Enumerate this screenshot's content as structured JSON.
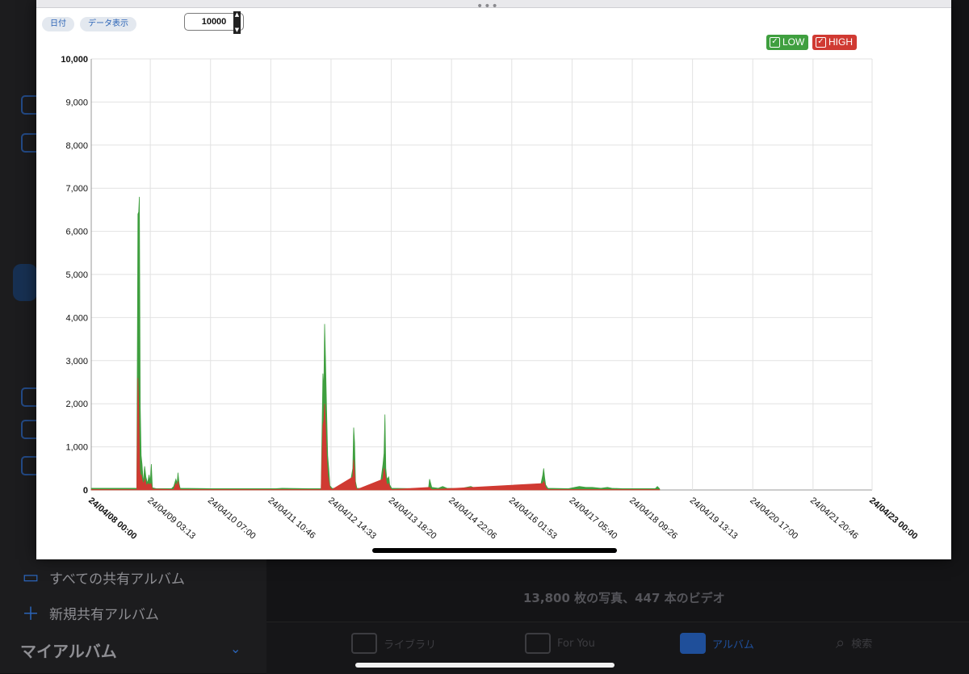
{
  "background": {
    "sidebar_items": [
      {
        "icon": "shared-album-icon",
        "label": "すべての共有アルバム"
      },
      {
        "icon": "plus-icon",
        "label": "新規共有アルバム"
      }
    ],
    "my_albums_heading": "マイアルバム",
    "counts_text": "13,800 枚の写真、447 本のビデオ",
    "tabs": [
      {
        "label": "ライブラリ",
        "icon": "library-icon"
      },
      {
        "label": "For You",
        "icon": "for-you-icon"
      },
      {
        "label": "アルバム",
        "icon": "album-icon"
      },
      {
        "label": "検索",
        "icon": "search-icon"
      }
    ],
    "accent": "#2b64b8"
  },
  "toolbar": {
    "date_button": "日付",
    "data_button": "データ表示",
    "max_value": "10000"
  },
  "legend": {
    "low_label": "LOW",
    "high_label": "HIGH",
    "low_color": "#3f9f3f",
    "high_color": "#d03a32"
  },
  "chart_data": {
    "type": "area",
    "ylim": [
      0,
      10000
    ],
    "yticks": [
      "0",
      "1,000",
      "2,000",
      "3,000",
      "4,000",
      "5,000",
      "6,000",
      "7,000",
      "8,000",
      "9,000",
      "10,000"
    ],
    "xlim": [
      "2024-04-08 00:00",
      "2024-04-23 00:00"
    ],
    "xticks": [
      {
        "label": "24/04/08 00:00",
        "t": 0,
        "bold": true
      },
      {
        "label": "24/04/09 03:13",
        "t": 27.22
      },
      {
        "label": "24/04/10 07:00",
        "t": 55.0
      },
      {
        "label": "24/04/11 10:46",
        "t": 82.77
      },
      {
        "label": "24/04/12 14:33",
        "t": 110.55
      },
      {
        "label": "24/04/13 18:20",
        "t": 138.33
      },
      {
        "label": "24/04/14 22:06",
        "t": 166.1
      },
      {
        "label": "24/04/16 01:53",
        "t": 193.88
      },
      {
        "label": "24/04/17 05:40",
        "t": 221.67
      },
      {
        "label": "24/04/18 09:26",
        "t": 249.43
      },
      {
        "label": "24/04/19 13:13",
        "t": 277.22
      },
      {
        "label": "24/04/20 17:00",
        "t": 305.0
      },
      {
        "label": "24/04/21 20:46",
        "t": 332.77
      },
      {
        "label": "24/04/23 00:00",
        "t": 360,
        "bold": true
      }
    ],
    "series": [
      {
        "name": "LOW",
        "color": "#3f9f3f",
        "points": [
          [
            0,
            40
          ],
          [
            15,
            40
          ],
          [
            21.0,
            40
          ],
          [
            21.5,
            6400
          ],
          [
            21.9,
            6450
          ],
          [
            22.2,
            6800
          ],
          [
            22.6,
            1900
          ],
          [
            23.0,
            800
          ],
          [
            23.4,
            600
          ],
          [
            24.0,
            150
          ],
          [
            24.6,
            550
          ],
          [
            25.2,
            300
          ],
          [
            26.0,
            150
          ],
          [
            26.6,
            350
          ],
          [
            27.2,
            200
          ],
          [
            27.7,
            600
          ],
          [
            28.2,
            50
          ],
          [
            30,
            30
          ],
          [
            37,
            30
          ],
          [
            38,
            80
          ],
          [
            39,
            250
          ],
          [
            39.6,
            150
          ],
          [
            40,
            400
          ],
          [
            40.5,
            150
          ],
          [
            41,
            40
          ],
          [
            55,
            30
          ],
          [
            85,
            30
          ],
          [
            88,
            40
          ],
          [
            100,
            30
          ],
          [
            106,
            30
          ],
          [
            106.8,
            2700
          ],
          [
            107.2,
            2300
          ],
          [
            107.6,
            3850
          ],
          [
            108,
            3050
          ],
          [
            108.5,
            1900
          ],
          [
            109,
            800
          ],
          [
            109.5,
            500
          ],
          [
            110,
            100
          ],
          [
            111,
            40
          ],
          [
            119,
            30
          ],
          [
            120.6,
            500
          ],
          [
            121.0,
            1450
          ],
          [
            121.4,
            1100
          ],
          [
            121.8,
            200
          ],
          [
            122.5,
            40
          ],
          [
            133,
            30
          ],
          [
            134.5,
            600
          ],
          [
            135,
            850
          ],
          [
            135.4,
            1750
          ],
          [
            135.8,
            500
          ],
          [
            136.2,
            300
          ],
          [
            136.6,
            250
          ],
          [
            137.2,
            300
          ],
          [
            137.6,
            120
          ],
          [
            138.5,
            40
          ],
          [
            150,
            30
          ],
          [
            155.5,
            40
          ],
          [
            156,
            250
          ],
          [
            156.5,
            150
          ],
          [
            157,
            60
          ],
          [
            160,
            40
          ],
          [
            162,
            80
          ],
          [
            164,
            40
          ],
          [
            170,
            30
          ],
          [
            175,
            80
          ],
          [
            177,
            40
          ],
          [
            200,
            30
          ],
          [
            207,
            60
          ],
          [
            208.2,
            350
          ],
          [
            208.6,
            500
          ],
          [
            209,
            300
          ],
          [
            209.5,
            120
          ],
          [
            210.5,
            40
          ],
          [
            220,
            30
          ],
          [
            225,
            80
          ],
          [
            228,
            60
          ],
          [
            231,
            60
          ],
          [
            235,
            40
          ],
          [
            238,
            60
          ],
          [
            240,
            40
          ],
          [
            245,
            30
          ],
          [
            260,
            30
          ],
          [
            261,
            80
          ],
          [
            262,
            30
          ]
        ]
      },
      {
        "name": "HIGH",
        "color": "#d03a32",
        "points": [
          [
            0,
            10
          ],
          [
            21.0,
            10
          ],
          [
            21.5,
            2600
          ],
          [
            21.9,
            1900
          ],
          [
            22.3,
            500
          ],
          [
            22.7,
            300
          ],
          [
            23.1,
            350
          ],
          [
            23.6,
            200
          ],
          [
            24.2,
            150
          ],
          [
            24.8,
            250
          ],
          [
            25.4,
            100
          ],
          [
            26.2,
            150
          ],
          [
            26.8,
            120
          ],
          [
            27.5,
            150
          ],
          [
            28.2,
            20
          ],
          [
            38,
            10
          ],
          [
            39,
            150
          ],
          [
            39.6,
            80
          ],
          [
            40,
            200
          ],
          [
            40.5,
            80
          ],
          [
            41,
            10
          ],
          [
            106,
            10
          ],
          [
            106.8,
            1500
          ],
          [
            107.2,
            1600
          ],
          [
            107.6,
            2000
          ],
          [
            108,
            1500
          ],
          [
            108.5,
            800
          ],
          [
            109,
            350
          ],
          [
            109.5,
            200
          ],
          [
            110,
            60
          ],
          [
            111,
            10
          ],
          [
            120.6,
            300
          ],
          [
            121.0,
            700
          ],
          [
            121.4,
            400
          ],
          [
            121.8,
            100
          ],
          [
            122.5,
            10
          ],
          [
            134.5,
            250
          ],
          [
            135,
            500
          ],
          [
            135.4,
            400
          ],
          [
            135.8,
            250
          ],
          [
            136.2,
            150
          ],
          [
            136.6,
            120
          ],
          [
            137.2,
            150
          ],
          [
            137.6,
            60
          ],
          [
            138.5,
            10
          ],
          [
            156,
            60
          ],
          [
            156.5,
            30
          ],
          [
            157,
            10
          ],
          [
            208.2,
            150
          ],
          [
            208.6,
            200
          ],
          [
            209,
            150
          ],
          [
            209.5,
            60
          ],
          [
            210.5,
            10
          ],
          [
            262,
            10
          ]
        ]
      }
    ]
  }
}
